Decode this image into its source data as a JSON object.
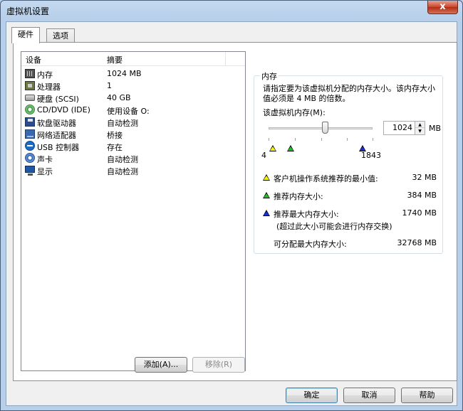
{
  "window": {
    "title": "虚拟机设置",
    "close_glyph": "x"
  },
  "tabs": [
    {
      "label": "硬件",
      "active": true
    },
    {
      "label": "选项",
      "active": false
    }
  ],
  "device_list": {
    "columns": [
      "设备",
      "摘要"
    ],
    "rows": [
      {
        "icon": "memory-icon",
        "name": "内存",
        "summary": "1024 MB"
      },
      {
        "icon": "processor-icon",
        "name": "处理器",
        "summary": "1"
      },
      {
        "icon": "hard-disk-icon",
        "name": "硬盘 (SCSI)",
        "summary": "40 GB"
      },
      {
        "icon": "cd-dvd-icon",
        "name": "CD/DVD (IDE)",
        "summary": "使用设备 O:"
      },
      {
        "icon": "floppy-icon",
        "name": "软盘驱动器",
        "summary": "自动检测"
      },
      {
        "icon": "network-adapter-icon",
        "name": "网络适配器",
        "summary": "桥接"
      },
      {
        "icon": "usb-icon",
        "name": "USB 控制器",
        "summary": "存在"
      },
      {
        "icon": "sound-card-icon",
        "name": "声卡",
        "summary": "自动检测"
      },
      {
        "icon": "display-icon",
        "name": "显示",
        "summary": "自动检测"
      }
    ]
  },
  "list_buttons": {
    "add": "添加(A)...",
    "remove": "移除(R)"
  },
  "memory": {
    "group_title": "内存",
    "description": "请指定要为该虚拟机分配的内存大小。该内存大小值必须是 4 MB 的倍数。",
    "field_label": "该虚拟机内存(M):",
    "value": "1024",
    "unit": "MB",
    "scale_min": "4",
    "scale_max": "1843",
    "slider_fraction": 0.555,
    "markers": {
      "min_recommended_fraction": 0.017,
      "recommended_fraction": 0.208,
      "max_recommended_fraction": 0.944
    },
    "colors": {
      "yellow": "#f8f500",
      "green": "#20c020",
      "blue": "#1c2ed6"
    },
    "info": [
      {
        "marker": "yellow",
        "label": "客户机操作系统推荐的最小值:",
        "value": "32 MB"
      },
      {
        "marker": "green",
        "label": "推荐内存大小:",
        "value": "384 MB"
      },
      {
        "marker": "blue",
        "label": "推荐最大内存大小:",
        "value": "1740 MB"
      }
    ],
    "swap_note": "(超过此大小可能会进行内存交换)",
    "max_alloc_label": "可分配最大内存大小:",
    "max_alloc_value": "32768 MB"
  },
  "dialog_buttons": {
    "ok": "确定",
    "cancel": "取消",
    "help": "帮助"
  }
}
